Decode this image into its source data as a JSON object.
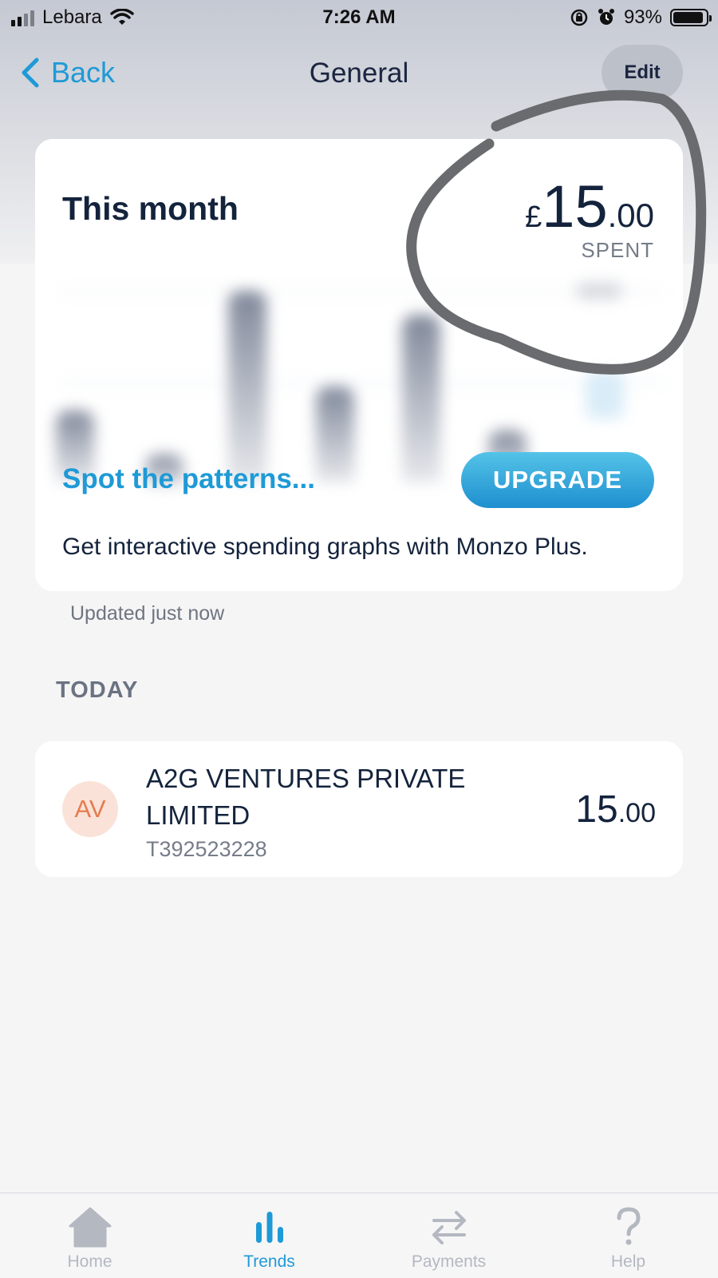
{
  "status_bar": {
    "carrier": "Lebara",
    "time": "7:26 AM",
    "battery": "93%",
    "battery_level": 0.93
  },
  "nav": {
    "back_label": "Back",
    "title": "General",
    "edit_label": "Edit"
  },
  "summary": {
    "heading": "This month",
    "currency": "£",
    "amount_main": "15",
    "amount_pence": ".00",
    "spent_label": "SPENT",
    "patterns_label": "Spot the patterns...",
    "upgrade_label": "UPGRADE",
    "promo_text": "Get interactive spending graphs with Monzo Plus."
  },
  "updated_text": "Updated just now",
  "section": {
    "title": "TODAY"
  },
  "transactions": [
    {
      "initials": "AV",
      "name": "A2G VENTURES PRIVATE LIMITED",
      "reference": "T392523228",
      "amount_main": "15",
      "amount_pence": ".00"
    }
  ],
  "tabs": [
    {
      "label": "Home",
      "icon": "home-icon",
      "active": false
    },
    {
      "label": "Trends",
      "icon": "trends-icon",
      "active": true
    },
    {
      "label": "Payments",
      "icon": "payments-icon",
      "active": false
    },
    {
      "label": "Help",
      "icon": "help-icon",
      "active": false
    }
  ],
  "colors": {
    "accent": "#1e9ad6",
    "text_dark": "#14233c",
    "avatar_bg": "#fbe2d8",
    "avatar_text": "#e47d4e",
    "annotation": "#6a6b6e"
  }
}
